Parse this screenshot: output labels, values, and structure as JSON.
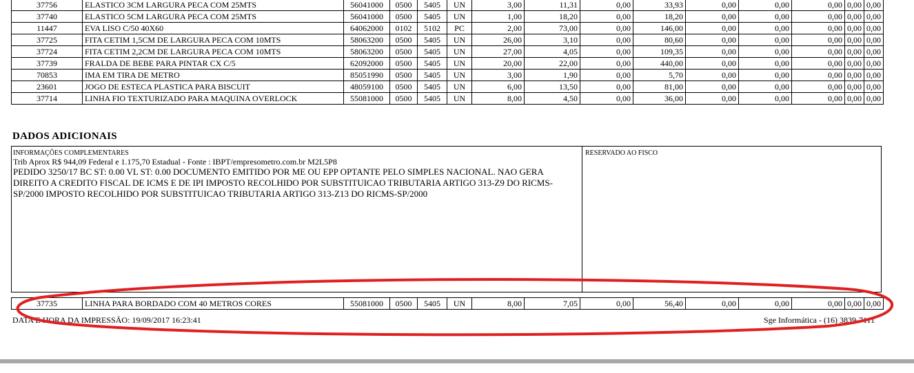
{
  "items": [
    {
      "code": "37756",
      "desc": "ELASTICO 3CM LARGURA PECA COM 25MTS",
      "ncm": "56041000",
      "cst": "0500",
      "cfop": "5405",
      "un": "UN",
      "qtd": "3,00",
      "vunit": "11,31",
      "desc_val": "0,00",
      "vtotal": "33,93",
      "bc": "0,00",
      "icms": "0,00",
      "ipi": "0,00",
      "aliq_icms": "0,00",
      "aliq_ipi": "0,00"
    },
    {
      "code": "37740",
      "desc": "ELASTICO 5CM LARGURA PECA COM 25MTS",
      "ncm": "56041000",
      "cst": "0500",
      "cfop": "5405",
      "un": "UN",
      "qtd": "1,00",
      "vunit": "18,20",
      "desc_val": "0,00",
      "vtotal": "18,20",
      "bc": "0,00",
      "icms": "0,00",
      "ipi": "0,00",
      "aliq_icms": "0,00",
      "aliq_ipi": "0,00"
    },
    {
      "code": "11447",
      "desc": "EVA LISO C/50 40X60",
      "ncm": "64062000",
      "cst": "0102",
      "cfop": "5102",
      "un": "PC",
      "qtd": "2,00",
      "vunit": "73,00",
      "desc_val": "0,00",
      "vtotal": "146,00",
      "bc": "0,00",
      "icms": "0,00",
      "ipi": "0,00",
      "aliq_icms": "0,00",
      "aliq_ipi": "0,00"
    },
    {
      "code": "37725",
      "desc": "FITA CETIM 1,5CM DE LARGURA PECA COM 10MTS",
      "ncm": "58063200",
      "cst": "0500",
      "cfop": "5405",
      "un": "UN",
      "qtd": "26,00",
      "vunit": "3,10",
      "desc_val": "0,00",
      "vtotal": "80,60",
      "bc": "0,00",
      "icms": "0,00",
      "ipi": "0,00",
      "aliq_icms": "0,00",
      "aliq_ipi": "0,00"
    },
    {
      "code": "37724",
      "desc": "FITA CETIM 2,2CM DE LARGURA PECA COM 10MTS",
      "ncm": "58063200",
      "cst": "0500",
      "cfop": "5405",
      "un": "UN",
      "qtd": "27,00",
      "vunit": "4,05",
      "desc_val": "0,00",
      "vtotal": "109,35",
      "bc": "0,00",
      "icms": "0,00",
      "ipi": "0,00",
      "aliq_icms": "0,00",
      "aliq_ipi": "0,00"
    },
    {
      "code": "37739",
      "desc": "FRALDA DE BEBE PARA PINTAR CX C/5",
      "ncm": "62092000",
      "cst": "0500",
      "cfop": "5405",
      "un": "UN",
      "qtd": "20,00",
      "vunit": "22,00",
      "desc_val": "0,00",
      "vtotal": "440,00",
      "bc": "0,00",
      "icms": "0,00",
      "ipi": "0,00",
      "aliq_icms": "0,00",
      "aliq_ipi": "0,00"
    },
    {
      "code": "70853",
      "desc": "IMA EM TIRA DE METRO",
      "ncm": "85051990",
      "cst": "0500",
      "cfop": "5405",
      "un": "UN",
      "qtd": "3,00",
      "vunit": "1,90",
      "desc_val": "0,00",
      "vtotal": "5,70",
      "bc": "0,00",
      "icms": "0,00",
      "ipi": "0,00",
      "aliq_icms": "0,00",
      "aliq_ipi": "0,00"
    },
    {
      "code": "23601",
      "desc": "JOGO DE ESTECA PLASTICA PARA BISCUIT",
      "ncm": "48059100",
      "cst": "0500",
      "cfop": "5405",
      "un": "UN",
      "qtd": "6,00",
      "vunit": "13,50",
      "desc_val": "0,00",
      "vtotal": "81,00",
      "bc": "0,00",
      "icms": "0,00",
      "ipi": "0,00",
      "aliq_icms": "0,00",
      "aliq_ipi": "0,00"
    },
    {
      "code": "37714",
      "desc": "LINHA FIO TEXTURIZADO PARA MAQUINA OVERLOCK",
      "ncm": "55081000",
      "cst": "0500",
      "cfop": "5405",
      "un": "UN",
      "qtd": "8,00",
      "vunit": "4,50",
      "desc_val": "0,00",
      "vtotal": "36,00",
      "bc": "0,00",
      "icms": "0,00",
      "ipi": "0,00",
      "aliq_icms": "0,00",
      "aliq_ipi": "0,00"
    }
  ],
  "extra_item": {
    "code": "37735",
    "desc": "LINHA PARA BORDADO COM 40 METROS CORES",
    "ncm": "55081000",
    "cst": "0500",
    "cfop": "5405",
    "un": "UN",
    "qtd": "8,00",
    "vunit": "7,05",
    "desc_val": "0,00",
    "vtotal": "56,40",
    "bc": "0,00",
    "icms": "0,00",
    "ipi": "0,00",
    "aliq_icms": "0,00",
    "aliq_ipi": "0,00"
  },
  "dados": {
    "title": "DADOS ADICIONAIS",
    "inf_label": "INFORMAÇÕES COMPLEMENTARES",
    "inf_line1": "Trib Aprox R$ 944,09 Federal e 1.175,70 Estadual - Fonte : IBPT/empresometro.com.br M2L5P8",
    "inf_text": "PEDIDO 3250/17 BC ST: 0.00 VL ST: 0.00 DOCUMENTO EMITIDO POR ME OU EPP OPTANTE PELO SIMPLES NACIONAL. NAO GERA DIREITO A CREDITO FISCAL DE ICMS E DE IPI IMPOSTO RECOLHIDO POR SUBSTITUICAO TRIBUTARIA ARTIGO 313-Z9 DO RICMS-SP/2000 IMPOSTO RECOLHIDO POR SUBSTITUICAO TRIBUTARIA ARTIGO 313-Z13 DO RICMS-SP/2000",
    "reserved_label": "RESERVADO AO FISCO"
  },
  "footer": {
    "print_datetime": "DATA E HORA DA IMPRESSÃO: 19/09/2017 16:23:41",
    "software": "Sge Informática - (16) 3839-7111"
  },
  "colors": {
    "annotation": "#e02020",
    "bar": "#a8a8a8"
  }
}
